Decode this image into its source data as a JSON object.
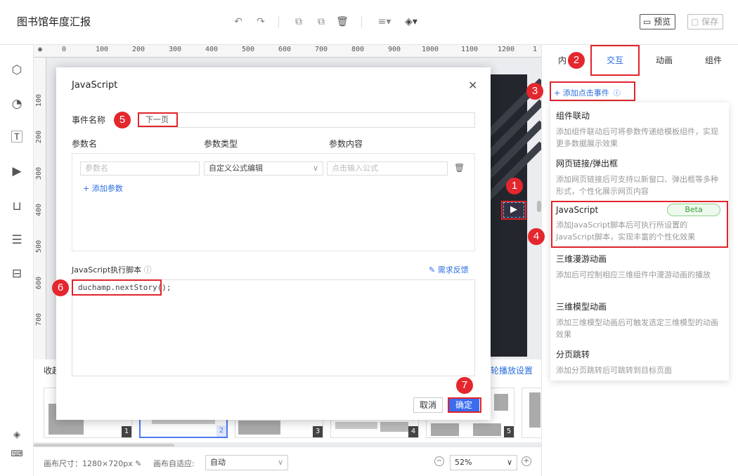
{
  "app": {
    "title": "图书馆年度汇报"
  },
  "toolbar": {
    "preview_label": "预览",
    "save_label": "保存"
  },
  "ruler": {
    "top_ticks": [
      "0",
      "100",
      "200",
      "300",
      "400",
      "500",
      "600",
      "700",
      "800",
      "900",
      "1000",
      "1100",
      "1200",
      "1"
    ],
    "left_ticks": [
      "100",
      "200",
      "300",
      "400",
      "500",
      "600",
      "700"
    ]
  },
  "right_panel": {
    "tabs": [
      "内",
      "交互",
      "动画",
      "组件"
    ],
    "add_click_event": "添加点击事件",
    "menu": [
      {
        "title": "组件联动",
        "desc": "添加组件联动后可将参数传递给模板组件，实现更多数据展示效果"
      },
      {
        "title": "网页链接/弹出框",
        "desc": "添加网页链接后可支持以新窗口、弹出框等多种形式，个性化展示网页内容"
      },
      {
        "title": "JavaScript",
        "badge": "Beta",
        "desc": "添加JavaScript脚本后可执行所设置的JavaScript脚本，实现丰富的个性化效果"
      },
      {
        "title": "三维漫游动画",
        "desc": "添加后可控制相应三维组件中漫游动画的播放"
      },
      {
        "title": "三维模型动画",
        "desc": "添加三维模型动画后可触发选定三维模型的动画效果"
      },
      {
        "title": "分页跳转",
        "desc": "添加分页跳转后可跳转到目标页面"
      }
    ]
  },
  "modal": {
    "title": "JavaScript",
    "event_name_label": "事件名称",
    "event_name_value": "下一页",
    "param_headers": [
      "参数名",
      "参数类型",
      "参数内容"
    ],
    "param_name_placeholder": "参数名",
    "param_type_value": "自定义公式编辑",
    "param_content_placeholder": "点击输入公式",
    "add_param": "添加参数",
    "script_label": "JavaScript执行脚本",
    "feedback": "需求反馈",
    "script_code": "duchamp.nextStory();",
    "cancel": "取消",
    "confirm": "确定"
  },
  "bottom": {
    "collapse_label": "收起",
    "carousel_settings": "轮播放设置",
    "thumbs": [
      "1",
      "2",
      "3",
      "4",
      "5"
    ]
  },
  "footer": {
    "canvas_size": "画布尺寸：1280×720px",
    "auto_fit_label": "画布自适应:",
    "auto_fit_value": "自动",
    "zoom": "52%"
  },
  "steps": [
    "1",
    "2",
    "3",
    "4",
    "5",
    "6",
    "7"
  ]
}
